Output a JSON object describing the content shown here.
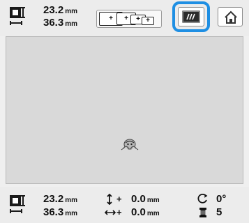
{
  "size": {
    "width": "23.2",
    "height": "36.3",
    "unit": "mm"
  },
  "frame_selector": {
    "plus_marks": [
      "+",
      "+",
      "+",
      "+"
    ]
  },
  "status": {
    "size_width": "23.2",
    "size_height": "36.3",
    "size_unit": "mm",
    "offset_vertical_sign": "+",
    "offset_vertical": "0.0",
    "offset_horizontal_sign": "+",
    "offset_horizontal": "0.0",
    "offset_unit": "mm",
    "rotation": "0°",
    "thread_count": "5"
  },
  "icons": {
    "size": "size-dimension-icon",
    "frame": "embroidery-frame-icon",
    "layout": "layout-edit-icon",
    "home": "home-icon",
    "vertical_move": "vertical-move-icon",
    "horizontal_move": "horizontal-move-icon",
    "rotation": "rotation-icon",
    "thread": "thread-spool-icon"
  },
  "colors": {
    "highlight": "#1f8fe3",
    "canvas": "#d9d9d9"
  }
}
